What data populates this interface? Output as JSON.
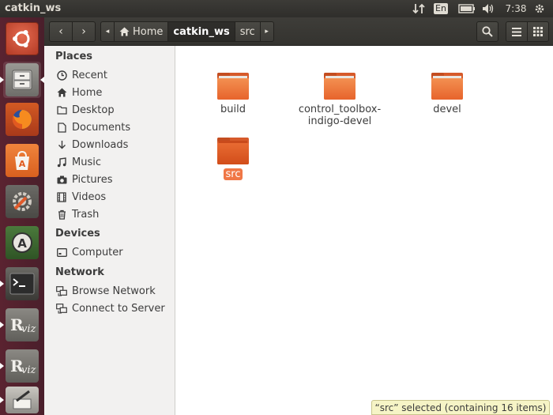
{
  "window": {
    "title": "catkin_ws"
  },
  "panel": {
    "keyboard": "En",
    "clock": "7:38"
  },
  "toolbar": {
    "back": "‹",
    "forward": "›",
    "path": [
      {
        "label": "Home"
      },
      {
        "label": "catkin_ws"
      },
      {
        "label": "src"
      }
    ]
  },
  "sidebar": {
    "places_title": "Places",
    "places": [
      {
        "label": "Recent",
        "icon": "clock-icon"
      },
      {
        "label": "Home",
        "icon": "home-icon"
      },
      {
        "label": "Desktop",
        "icon": "folder-icon"
      },
      {
        "label": "Documents",
        "icon": "document-icon"
      },
      {
        "label": "Downloads",
        "icon": "download-icon"
      },
      {
        "label": "Music",
        "icon": "music-icon"
      },
      {
        "label": "Pictures",
        "icon": "camera-icon"
      },
      {
        "label": "Videos",
        "icon": "film-icon"
      },
      {
        "label": "Trash",
        "icon": "trash-icon"
      }
    ],
    "devices_title": "Devices",
    "devices": [
      {
        "label": "Computer",
        "icon": "drive-icon"
      }
    ],
    "network_title": "Network",
    "network": [
      {
        "label": "Browse Network",
        "icon": "network-icon"
      },
      {
        "label": "Connect to Server",
        "icon": "server-icon"
      }
    ]
  },
  "files": [
    {
      "name": "build"
    },
    {
      "name": "control_toolbox-indigo-devel",
      "line1": "control_toolbox-",
      "line2": "indigo-devel"
    },
    {
      "name": "devel"
    },
    {
      "name": "src",
      "selected": true
    }
  ],
  "status": {
    "text": "“src” selected  (containing 16 items)"
  },
  "colors": {
    "accent": "#e95420",
    "launcher": "#4a1f2b",
    "selection": "#f07746"
  }
}
